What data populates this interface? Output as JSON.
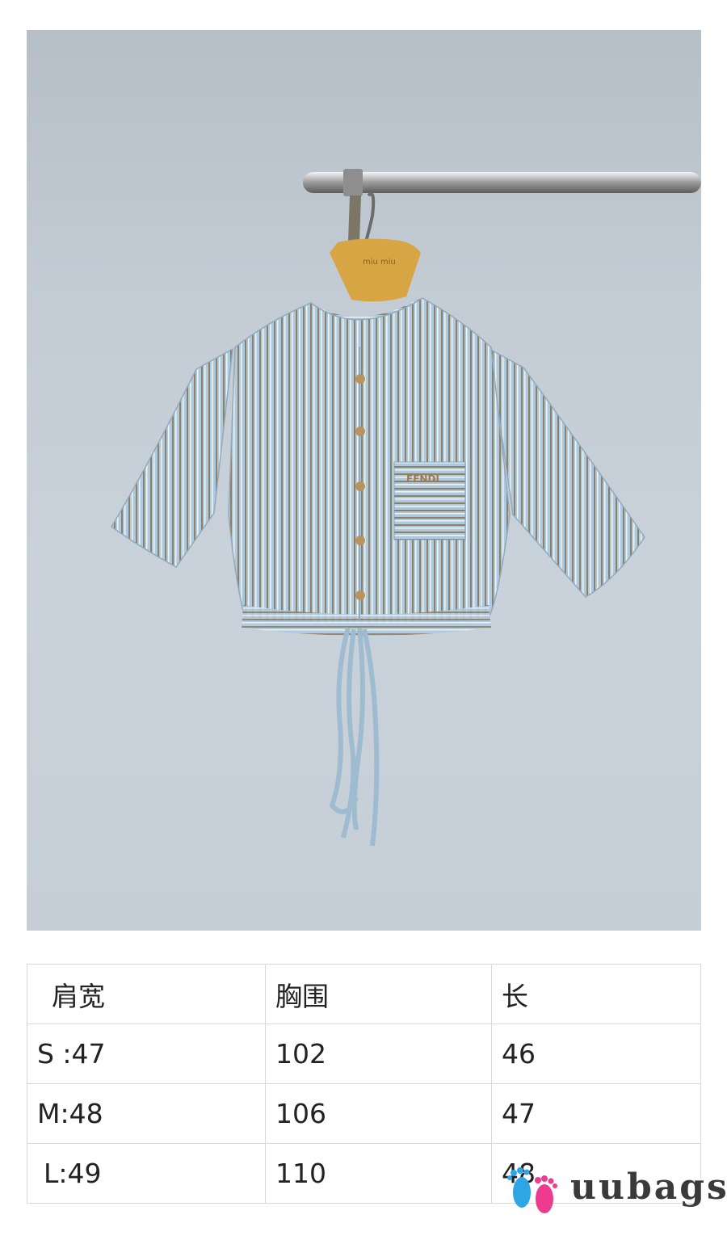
{
  "product": {
    "hanger_brand": "miu miu",
    "pocket_logo": "FENDI"
  },
  "size_table": {
    "headers": [
      "肩宽",
      "胸围",
      "长"
    ],
    "rows": [
      [
        "S :47",
        "102",
        "46"
      ],
      [
        "M:48",
        "106",
        "47"
      ],
      [
        "L:49",
        "110",
        "48"
      ]
    ]
  },
  "watermark": {
    "text": "uubags",
    "icon": "footprints-icon"
  },
  "colors": {
    "wall": "#c3ccd4",
    "shirt": "#a9c6dc",
    "stripe": "#8a7a62",
    "hanger": "#d7a543",
    "foot_blue": "#2ea6e6",
    "foot_pink": "#ee3b8f"
  }
}
